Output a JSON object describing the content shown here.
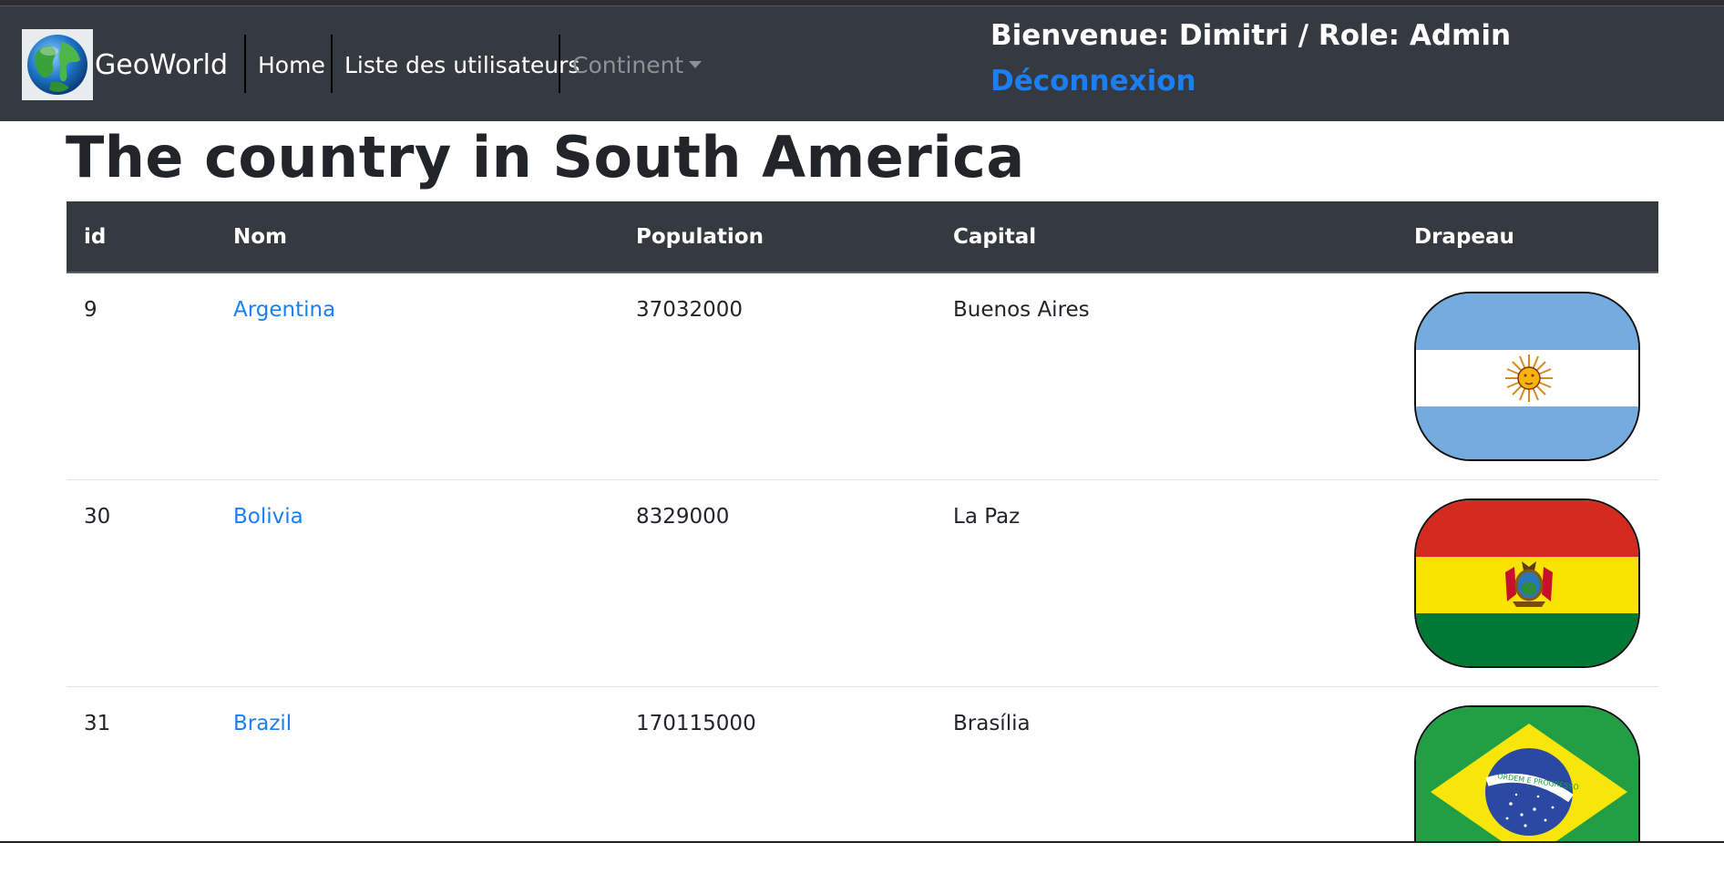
{
  "navbar": {
    "brand": "GeoWorld",
    "links": [
      "Home",
      "Liste des utilisateurs"
    ],
    "continent_label": "Continent",
    "welcome": "Bienvenue: Dimitri / Role: Admin",
    "logout": "Déconnexion"
  },
  "page": {
    "title": "The country in South America"
  },
  "table": {
    "headers": [
      "id",
      "Nom",
      "Population",
      "Capital",
      "Drapeau"
    ],
    "rows": [
      {
        "id": "9",
        "name": "Argentina",
        "population": "37032000",
        "capital": "Buenos Aires",
        "flag": "argentina-flag"
      },
      {
        "id": "30",
        "name": "Bolivia",
        "population": "8329000",
        "capital": "La Paz",
        "flag": "bolivia-flag"
      },
      {
        "id": "31",
        "name": "Brazil",
        "population": "170115000",
        "capital": "Brasília",
        "flag": "brazil-flag"
      }
    ]
  },
  "brazil_flag_motto": "ORDEM E PROGRESSO",
  "colors": {
    "navbar_bg": "#343a40",
    "link": "#1a7ff5",
    "muted": "#8c9196"
  }
}
